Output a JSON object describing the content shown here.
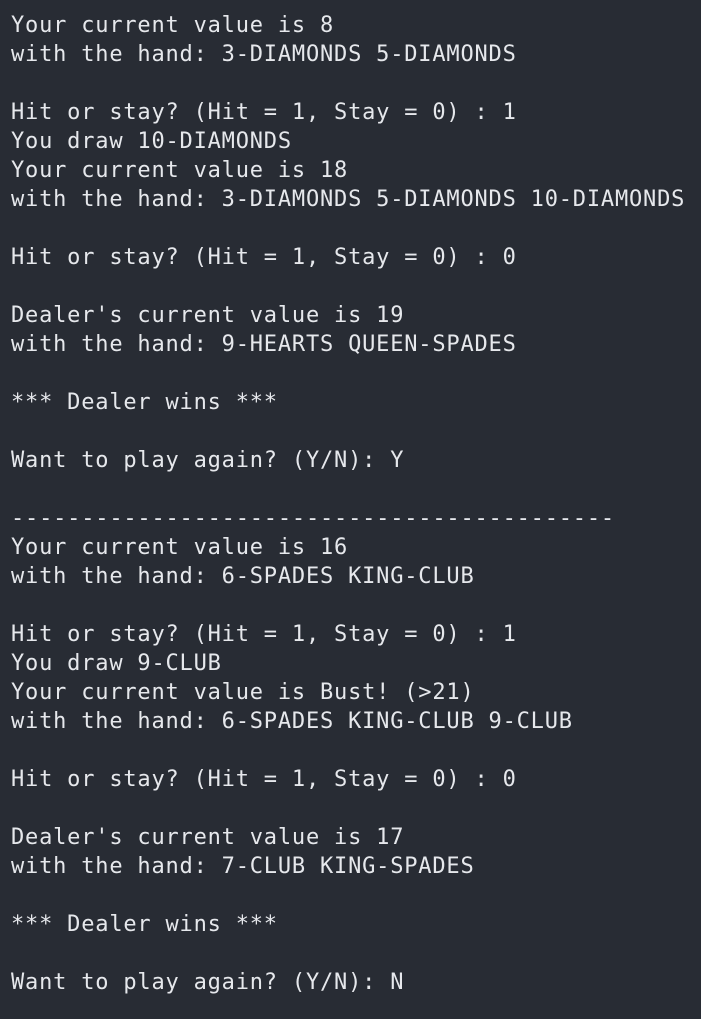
{
  "terminal": {
    "background": "#282c34",
    "foreground": "#e6e8ec",
    "lines": [
      "Your current value is 8",
      "with the hand: 3-DIAMONDS 5-DIAMONDS",
      "",
      "Hit or stay? (Hit = 1, Stay = 0) : 1",
      "You draw 10-DIAMONDS",
      "Your current value is 18",
      "with the hand: 3-DIAMONDS 5-DIAMONDS 10-DIAMONDS",
      "",
      "Hit or stay? (Hit = 1, Stay = 0) : 0",
      "",
      "Dealer's current value is 19",
      "with the hand: 9-HEARTS QUEEN-SPADES",
      "",
      "*** Dealer wins ***",
      "",
      "Want to play again? (Y/N): Y",
      "",
      "-------------------------------------------",
      "Your current value is 16",
      "with the hand: 6-SPADES KING-CLUB",
      "",
      "Hit or stay? (Hit = 1, Stay = 0) : 1",
      "You draw 9-CLUB",
      "Your current value is Bust! (>21)",
      "with the hand: 6-SPADES KING-CLUB 9-CLUB",
      "",
      "Hit or stay? (Hit = 1, Stay = 0) : 0",
      "",
      "Dealer's current value is 17",
      "with the hand: 7-CLUB KING-SPADES",
      "",
      "*** Dealer wins ***",
      "",
      "Want to play again? (Y/N): N"
    ]
  }
}
